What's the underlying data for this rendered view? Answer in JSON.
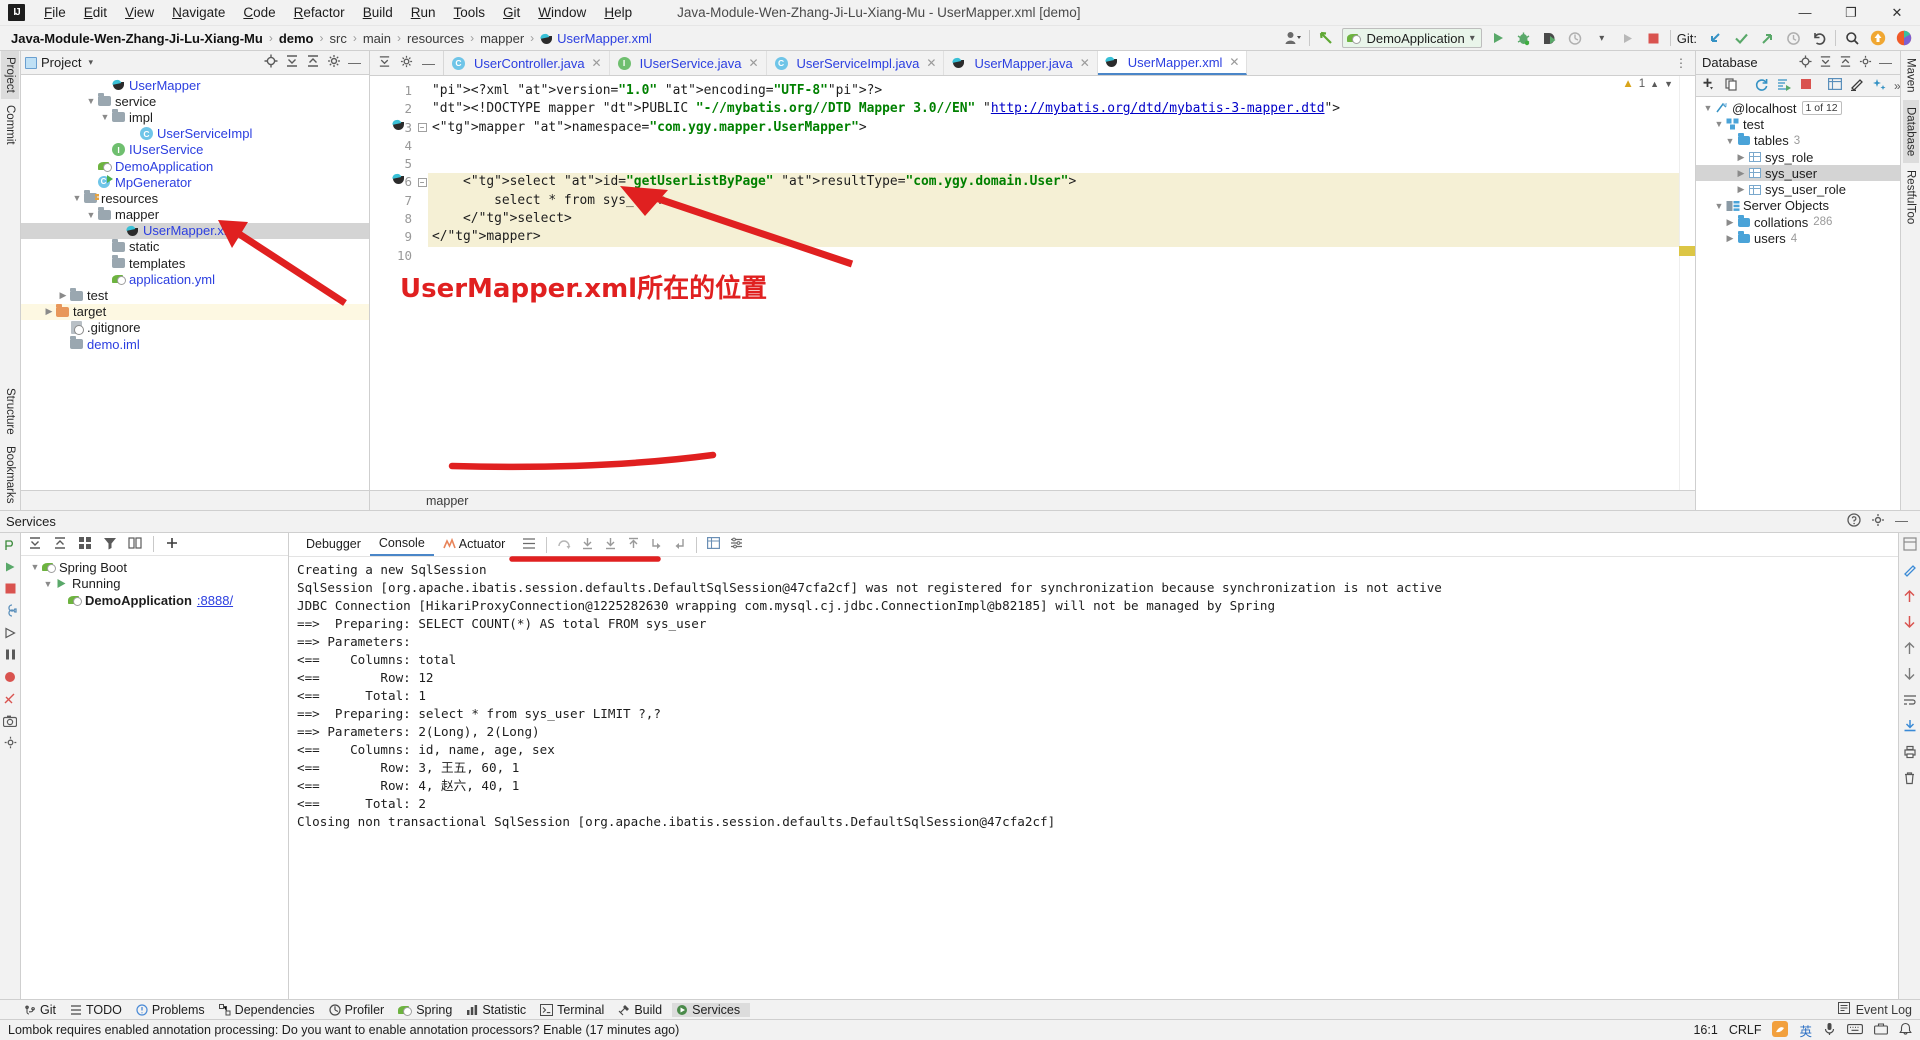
{
  "window": {
    "title": "Java-Module-Wen-Zhang-Ji-Lu-Xiang-Mu - UserMapper.xml [demo]",
    "logo": "IJ",
    "minimize": "—",
    "maximize": "❐",
    "close": "✕"
  },
  "menu": [
    "File",
    "Edit",
    "View",
    "Navigate",
    "Code",
    "Refactor",
    "Build",
    "Run",
    "Tools",
    "Git",
    "Window",
    "Help"
  ],
  "breadcrumbs": [
    {
      "label": "Java-Module-Wen-Zhang-Ji-Lu-Xiang-Mu",
      "style": "bold"
    },
    {
      "label": "demo",
      "style": "bold"
    },
    {
      "label": "src",
      "style": "dim"
    },
    {
      "label": "main",
      "style": "dim"
    },
    {
      "label": "resources",
      "style": "dim"
    },
    {
      "label": "mapper",
      "style": "dim"
    },
    {
      "label": "UserMapper.xml",
      "style": "link"
    }
  ],
  "toolbar": {
    "run_config": "DemoApplication",
    "git_label": "Git:",
    "icons": [
      "profile-icon",
      "search-everywhere-icon",
      "run-icon",
      "debug-icon",
      "run-coverage-icon",
      "profiler-icon",
      "rerun-icon",
      "stop-icon",
      "git-update-icon",
      "git-commit-icon",
      "git-push-icon",
      "git-history-icon",
      "git-rollback-icon",
      "search-icon",
      "update-icon",
      "ide-icon"
    ]
  },
  "left_rail": [
    "Project",
    "Commit",
    "Structure",
    "Bookmarks"
  ],
  "right_rail": [
    "Maven",
    "Database",
    "RestfulToo"
  ],
  "project_panel": {
    "title": "Project",
    "tree": [
      {
        "indent": 5,
        "chev": "",
        "icon": "mybatis-icon",
        "label": "UserMapper",
        "color": "blue",
        "state": "none"
      },
      {
        "indent": 4,
        "chev": "v",
        "icon": "folder-icon",
        "label": "service",
        "color": "dark",
        "state": "none"
      },
      {
        "indent": 5,
        "chev": "v",
        "icon": "folder-icon",
        "label": "impl",
        "color": "dark",
        "state": "none"
      },
      {
        "indent": 7,
        "chev": "",
        "icon": "class-icon",
        "label": "UserServiceImpl",
        "color": "blue",
        "state": "none"
      },
      {
        "indent": 5,
        "chev": "",
        "icon": "interface-icon",
        "label": "IUserService",
        "color": "blue",
        "state": "none"
      },
      {
        "indent": 4,
        "chev": "",
        "icon": "spring-class-icon",
        "label": "DemoApplication",
        "color": "blue",
        "state": "none"
      },
      {
        "indent": 4,
        "chev": "",
        "icon": "java-run-icon",
        "label": "MpGenerator",
        "color": "blue",
        "state": "none"
      },
      {
        "indent": 3,
        "chev": "v",
        "icon": "resources-folder-icon",
        "label": "resources",
        "color": "dark",
        "state": "none"
      },
      {
        "indent": 4,
        "chev": "v",
        "icon": "folder-icon",
        "label": "mapper",
        "color": "dark",
        "state": "none"
      },
      {
        "indent": 6,
        "chev": "",
        "icon": "mybatis-icon",
        "label": "UserMapper.xml",
        "color": "blue",
        "state": "selected"
      },
      {
        "indent": 5,
        "chev": "",
        "icon": "folder-icon",
        "label": "static",
        "color": "dark",
        "state": "none"
      },
      {
        "indent": 5,
        "chev": "",
        "icon": "folder-icon",
        "label": "templates",
        "color": "dark",
        "state": "none"
      },
      {
        "indent": 5,
        "chev": "",
        "icon": "yaml-icon",
        "label": "application.yml",
        "color": "blue",
        "state": "none"
      },
      {
        "indent": 2,
        "chev": ">",
        "icon": "folder-icon",
        "label": "test",
        "color": "dark",
        "state": "none"
      },
      {
        "indent": 1,
        "chev": ">",
        "icon": "folder-orange-icon",
        "label": "target",
        "color": "dark",
        "state": "highlight"
      },
      {
        "indent": 2,
        "chev": "",
        "icon": "gitignore-icon",
        "label": ".gitignore",
        "color": "dark",
        "state": "none"
      },
      {
        "indent": 2,
        "chev": "",
        "icon": "iml-icon",
        "label": "demo.iml",
        "color": "blue",
        "state": "none"
      }
    ]
  },
  "editor": {
    "tabs": [
      {
        "label": "UserController.java",
        "icon": "class-icon",
        "active": false
      },
      {
        "label": "IUserService.java",
        "icon": "interface-icon",
        "active": false
      },
      {
        "label": "UserServiceImpl.java",
        "icon": "class-icon",
        "active": false
      },
      {
        "label": "UserMapper.java",
        "icon": "mybatis-icon",
        "active": false
      },
      {
        "label": "UserMapper.xml",
        "icon": "mybatis-icon",
        "active": true
      }
    ],
    "warning_count": "1",
    "breadcrumb": "mapper",
    "lines": [
      {
        "no": "1",
        "text": "<?xml version=\"1.0\" encoding=\"UTF-8\"?>"
      },
      {
        "no": "2",
        "text": "<!DOCTYPE mapper PUBLIC \"-//mybatis.org//DTD Mapper 3.0//EN\" \"http://mybatis.org/dtd/mybatis-3-mapper.dtd\">"
      },
      {
        "no": "3",
        "text": "<mapper namespace=\"com.ygy.mapper.UserMapper\">"
      },
      {
        "no": "4",
        "text": ""
      },
      {
        "no": "5",
        "text": ""
      },
      {
        "no": "6",
        "text": "    <select id=\"getUserListByPage\" resultType=\"com.ygy.domain.User\">"
      },
      {
        "no": "7",
        "text": "        select * from sys_user"
      },
      {
        "no": "8",
        "text": "    </select>"
      },
      {
        "no": "9",
        "text": "</mapper>"
      },
      {
        "no": "10",
        "text": ""
      }
    ]
  },
  "database_panel": {
    "title": "Database",
    "tree": [
      {
        "indent": 0,
        "chev": "v",
        "icon": "datasource-icon",
        "label": "@localhost",
        "badge": "1 of 12",
        "count": "",
        "sel": false
      },
      {
        "indent": 1,
        "chev": "v",
        "icon": "schema-icon",
        "label": "test",
        "badge": "",
        "count": "",
        "sel": false
      },
      {
        "indent": 2,
        "chev": "v",
        "icon": "db-folder-icon",
        "label": "tables",
        "badge": "",
        "count": "3",
        "sel": false
      },
      {
        "indent": 3,
        "chev": ">",
        "icon": "table-icon",
        "label": "sys_role",
        "badge": "",
        "count": "",
        "sel": false
      },
      {
        "indent": 3,
        "chev": ">",
        "icon": "table-icon",
        "label": "sys_user",
        "badge": "",
        "count": "",
        "sel": true
      },
      {
        "indent": 3,
        "chev": ">",
        "icon": "table-icon",
        "label": "sys_user_role",
        "badge": "",
        "count": "",
        "sel": false
      },
      {
        "indent": 1,
        "chev": "v",
        "icon": "server-objects-icon",
        "label": "Server Objects",
        "badge": "",
        "count": "",
        "sel": false
      },
      {
        "indent": 2,
        "chev": ">",
        "icon": "db-folder-icon",
        "label": "collations",
        "badge": "",
        "count": "286",
        "sel": false
      },
      {
        "indent": 2,
        "chev": ">",
        "icon": "db-folder-icon",
        "label": "users",
        "badge": "",
        "count": "4",
        "sel": false
      }
    ]
  },
  "services": {
    "title": "Services",
    "tree": [
      {
        "indent": 0,
        "chev": "v",
        "icon": "spring-boot-icon",
        "label": "Spring Boot",
        "link": "",
        "bold": false
      },
      {
        "indent": 1,
        "chev": "v",
        "icon": "run-green-icon",
        "label": "Running",
        "link": "",
        "bold": false
      },
      {
        "indent": 2,
        "chev": "",
        "icon": "spring-class-icon",
        "label": "DemoApplication",
        "link": ":8888/",
        "bold": true
      }
    ],
    "console_tabs": [
      {
        "label": "Debugger",
        "sel": false,
        "icon": ""
      },
      {
        "label": "Console",
        "sel": true,
        "icon": ""
      },
      {
        "label": "Actuator",
        "sel": false,
        "icon": "actuator-icon"
      }
    ],
    "console_output": [
      "Creating a new SqlSession",
      "SqlSession [org.apache.ibatis.session.defaults.DefaultSqlSession@47cfa2cf] was not registered for synchronization because synchronization is not active",
      "JDBC Connection [HikariProxyConnection@1225282630 wrapping com.mysql.cj.jdbc.ConnectionImpl@b82185] will not be managed by Spring",
      "==>  Preparing: SELECT COUNT(*) AS total FROM sys_user",
      "==> Parameters: ",
      "<==    Columns: total",
      "<==        Row: 12",
      "<==      Total: 1",
      "==>  Preparing: select * from sys_user LIMIT ?,?",
      "==> Parameters: 2(Long), 2(Long)",
      "<==    Columns: id, name, age, sex",
      "<==        Row: 3, 王五, 60, 1",
      "<==        Row: 4, 赵六, 40, 1",
      "<==      Total: 2",
      "Closing non transactional SqlSession [org.apache.ibatis.session.defaults.DefaultSqlSession@47cfa2cf]"
    ]
  },
  "bottom_tools": [
    {
      "label": "Git",
      "icon": "git-icon",
      "sel": false
    },
    {
      "label": "TODO",
      "icon": "todo-icon",
      "sel": false
    },
    {
      "label": "Problems",
      "icon": "problems-icon",
      "sel": false
    },
    {
      "label": "Dependencies",
      "icon": "dependencies-icon",
      "sel": false
    },
    {
      "label": "Profiler",
      "icon": "profiler-icon",
      "sel": false
    },
    {
      "label": "Spring",
      "icon": "spring-icon",
      "sel": false
    },
    {
      "label": "Statistic",
      "icon": "statistic-icon",
      "sel": false
    },
    {
      "label": "Terminal",
      "icon": "terminal-icon",
      "sel": false
    },
    {
      "label": "Build",
      "icon": "build-icon",
      "sel": false
    },
    {
      "label": "Services",
      "icon": "services-icon",
      "sel": true
    }
  ],
  "bottom_right": "Event Log",
  "statusbar": {
    "message": "Lombok requires enabled annotation processing: Do you want to enable annotation processors? Enable (17 minutes ago)",
    "caret": "16:1",
    "line_sep": "CRLF",
    "ime": "英"
  },
  "annotations": {
    "caption": "UserMapper.xml所在的位置",
    "color": "#e02020"
  }
}
